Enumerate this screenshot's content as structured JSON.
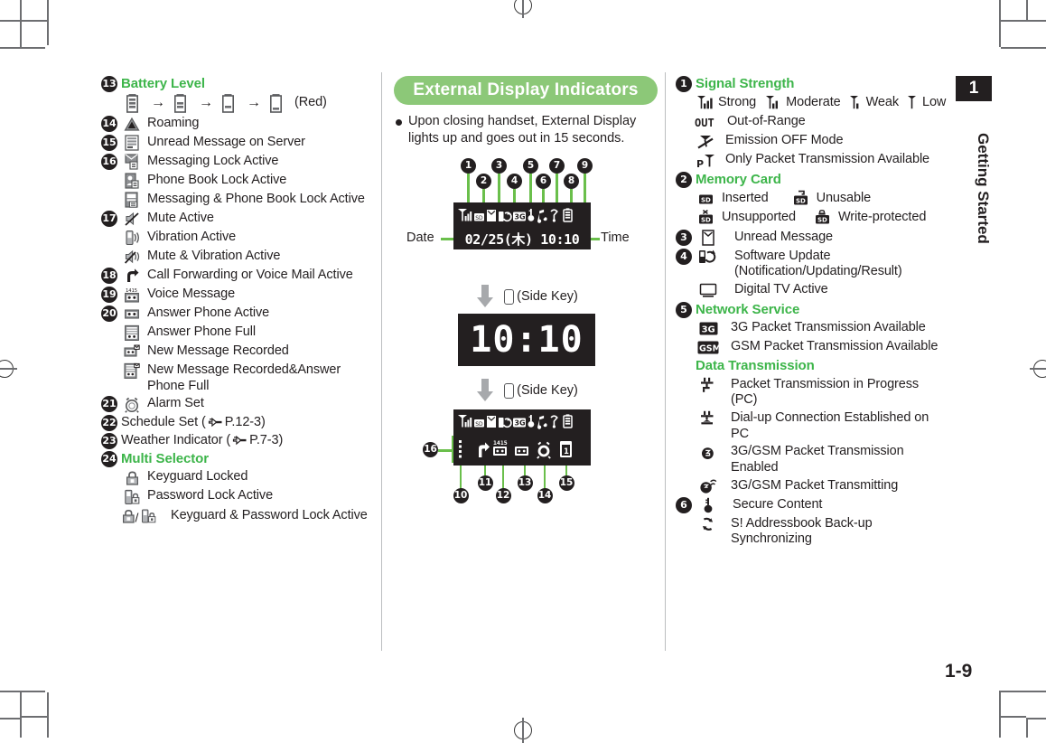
{
  "page": {
    "number": "1-9",
    "chapter_tab": {
      "number": "1",
      "title": "Getting Started"
    }
  },
  "left_column": {
    "items": [
      {
        "num": "13",
        "icon": "battery-level-icons",
        "label": "Battery Level",
        "green": true,
        "type": "heading"
      },
      {
        "num": "",
        "icon": "battery-progression",
        "label": "(Red)",
        "type": "battery-row"
      },
      {
        "num": "14",
        "icon": "roaming-icon",
        "label": "Roaming"
      },
      {
        "num": "15",
        "icon": "unread-message-server-icon",
        "label": "Unread Message on Server"
      },
      {
        "num": "16",
        "icon": "messaging-lock-icon",
        "label": "Messaging Lock Active"
      },
      {
        "num": "",
        "icon": "phonebook-lock-icon",
        "label": "Phone Book Lock Active"
      },
      {
        "num": "",
        "icon": "messaging-phonebook-lock-icon",
        "label": "Messaging & Phone Book Lock Active"
      },
      {
        "num": "17",
        "icon": "mute-icon",
        "label": "Mute Active"
      },
      {
        "num": "",
        "icon": "vibration-icon",
        "label": "Vibration Active"
      },
      {
        "num": "",
        "icon": "mute-vibration-icon",
        "label": "Mute & Vibration Active"
      },
      {
        "num": "18",
        "icon": "call-forwarding-icon",
        "label": "Call Forwarding or Voice Mail Active"
      },
      {
        "num": "19",
        "icon": "voice-message-icon",
        "label": "Voice Message"
      },
      {
        "num": "20",
        "icon": "answer-phone-active-icon",
        "label": "Answer Phone Active"
      },
      {
        "num": "",
        "icon": "answer-phone-full-icon",
        "label": "Answer Phone Full"
      },
      {
        "num": "",
        "icon": "new-message-recorded-icon",
        "label": "New Message Recorded"
      },
      {
        "num": "",
        "icon": "new-message-recorded-full-icon",
        "label": "New Message Recorded&Answer Phone Full"
      },
      {
        "num": "21",
        "icon": "alarm-set-icon",
        "label": "Alarm Set"
      },
      {
        "num": "22",
        "icon": "",
        "label": "Schedule Set (",
        "ref": "P.12-3",
        "suffix": ")"
      },
      {
        "num": "23",
        "icon": "",
        "label": "Weather Indicator (",
        "ref": "P.7-3",
        "suffix": ")"
      },
      {
        "num": "24",
        "icon": "",
        "label": "Multi Selector",
        "green": true,
        "type": "heading"
      },
      {
        "num": "",
        "icon": "keyguard-locked-icon",
        "label": "Keyguard Locked"
      },
      {
        "num": "",
        "icon": "password-lock-icon",
        "label": "Password Lock Active"
      },
      {
        "num": "",
        "icon": "keyguard-password-lock-icon",
        "label": "Keyguard & Password Lock Active"
      }
    ]
  },
  "mid_column": {
    "heading": "External Display Indicators",
    "bullet": "Upon closing handset, External Display lights up and goes out in 15 seconds.",
    "lcd_top": {
      "date_label": "Date",
      "time_label": "Time",
      "display_text": "02/25(木) 10:10",
      "callouts": [
        "1",
        "2",
        "3",
        "4",
        "5",
        "6",
        "7",
        "8",
        "9"
      ]
    },
    "step1": {
      "arrow": "down-arrow",
      "key": "Side Key",
      "key_text": "(Side Key)"
    },
    "clock": {
      "time": "10:10"
    },
    "step2": {
      "arrow": "down-arrow",
      "key": "Side Key",
      "key_text": "(Side Key)"
    },
    "lcd_bottom": {
      "callouts": [
        "10",
        "11",
        "12",
        "13",
        "14",
        "15",
        "16"
      ],
      "time_badge": "14:15"
    }
  },
  "right_column": {
    "items": [
      {
        "num": "1",
        "label": "Signal Strength",
        "green": true,
        "type": "heading"
      },
      {
        "type": "signal-row",
        "entries": [
          {
            "icon": "signal-strong-icon",
            "label": "Strong"
          },
          {
            "icon": "signal-moderate-icon",
            "label": "Moderate"
          },
          {
            "icon": "signal-weak-icon",
            "label": "Weak"
          },
          {
            "icon": "signal-low-icon",
            "label": "Low"
          }
        ]
      },
      {
        "num": "",
        "icon": "out-of-range-icon",
        "label": "Out-of-Range"
      },
      {
        "num": "",
        "icon": "emission-off-icon",
        "label": "Emission OFF Mode"
      },
      {
        "num": "",
        "icon": "packet-only-icon",
        "label": "Only Packet Transmission Available"
      },
      {
        "num": "2",
        "label": "Memory Card",
        "green": true,
        "type": "heading"
      },
      {
        "type": "pair-row",
        "entries": [
          {
            "icon": "sd-inserted-icon",
            "label": "Inserted"
          },
          {
            "icon": "sd-unusable-icon",
            "label": "Unusable"
          }
        ]
      },
      {
        "type": "pair-row",
        "entries": [
          {
            "icon": "sd-unsupported-icon",
            "label": "Unsupported"
          },
          {
            "icon": "sd-write-protected-icon",
            "label": "Write-protected"
          }
        ]
      },
      {
        "num": "3",
        "icon": "unread-message-icon",
        "label": "Unread Message"
      },
      {
        "num": "4",
        "icon": "software-update-icon",
        "label": "Software Update",
        "label2": "(Notification/Updating/Result)"
      },
      {
        "num": "",
        "icon": "digital-tv-icon",
        "label": "Digital TV Active"
      },
      {
        "num": "5",
        "label": "Network Service",
        "green": true,
        "type": "heading"
      },
      {
        "num": "",
        "icon": "3g-packet-icon",
        "label": "3G Packet Transmission Available"
      },
      {
        "num": "",
        "icon": "gsm-packet-icon",
        "label": "GSM Packet Transmission Available"
      },
      {
        "num": "",
        "label": "Data Transmission",
        "green": true,
        "type": "subheading"
      },
      {
        "num": "",
        "icon": "packet-in-progress-pc-icon",
        "label": "Packet Transmission in Progress (PC)"
      },
      {
        "num": "",
        "icon": "dialup-established-pc-icon",
        "label": "Dial-up Connection Established on PC"
      },
      {
        "num": "",
        "icon": "packet-enabled-icon",
        "label": "3G/GSM Packet Transmission Enabled"
      },
      {
        "num": "",
        "icon": "packet-transmitting-icon",
        "label": "3G/GSM Packet Transmitting"
      },
      {
        "num": "6",
        "icon": "secure-content-icon",
        "label": "Secure Content"
      },
      {
        "num": "",
        "icon": "addressbook-sync-icon",
        "label": "S! Addressbook Back-up Synchronizing"
      }
    ]
  },
  "colors": {
    "heading_green": "#3DB54A",
    "pill_green": "#8CC878",
    "leader_green": "#6ABF4B",
    "ink": "#231f20"
  }
}
